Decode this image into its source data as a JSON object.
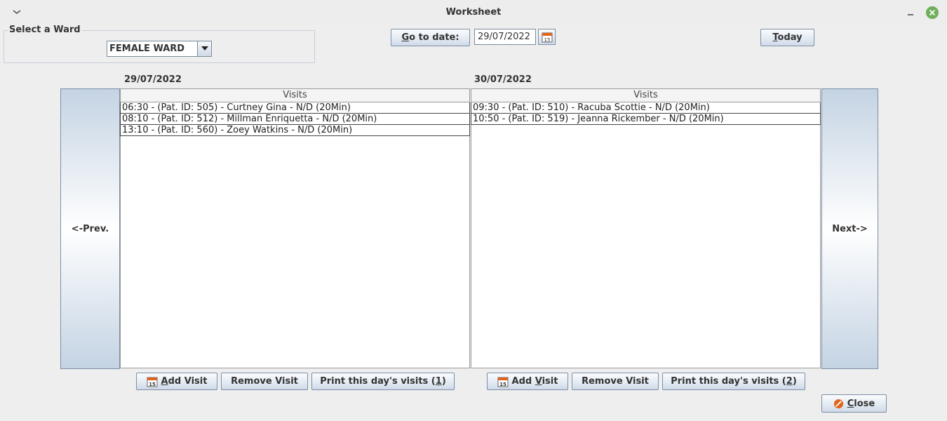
{
  "window": {
    "title": "Worksheet"
  },
  "ward": {
    "group_label": "Select a Ward",
    "selected": "FEMALE WARD"
  },
  "toolbar": {
    "goto_prefix": "",
    "goto_underline": "G",
    "goto_rest": "o to date:",
    "date_value": "29/07/2022",
    "today_underline": "T",
    "today_rest": "oday"
  },
  "nav": {
    "prev_label": "<-Prev.",
    "next_label": "Next->"
  },
  "days": [
    {
      "date": "29/07/2022",
      "column_header": "Visits",
      "visits": [
        "06:30 - (Pat. ID: 505) - Curtney Gina - N/D (20Min)",
        "08:10 - (Pat. ID: 512) - Millman Enriquetta - N/D (20Min)",
        "13:10 - (Pat. ID: 560) - Zoey Watkins - N/D (20Min)"
      ],
      "add_underline": "A",
      "add_rest": "dd Visit",
      "remove_label": "Remove Visit",
      "print_prefix": "Print this day's visits (",
      "print_key": "1",
      "print_suffix": ")"
    },
    {
      "date": "30/07/2022",
      "column_header": "Visits",
      "visits": [
        "09:30 - (Pat. ID: 510) - Racuba Scottie - N/D (20Min)",
        "10:50 - (Pat. ID: 519) - Jeanna Rickember - N/D (20Min)"
      ],
      "add_prefix": "Add ",
      "add_underline": "V",
      "add_rest": "isit",
      "remove_label": "Remove Visit",
      "print_prefix": "Print this day's visits (",
      "print_key": "2",
      "print_suffix": ")"
    }
  ],
  "footer": {
    "close_underline": "C",
    "close_rest": "lose"
  },
  "colors": {
    "close_circle": "#6fae5a",
    "cancel_icon": "#e0651c",
    "nav_gradient": "#c4d3e3"
  }
}
